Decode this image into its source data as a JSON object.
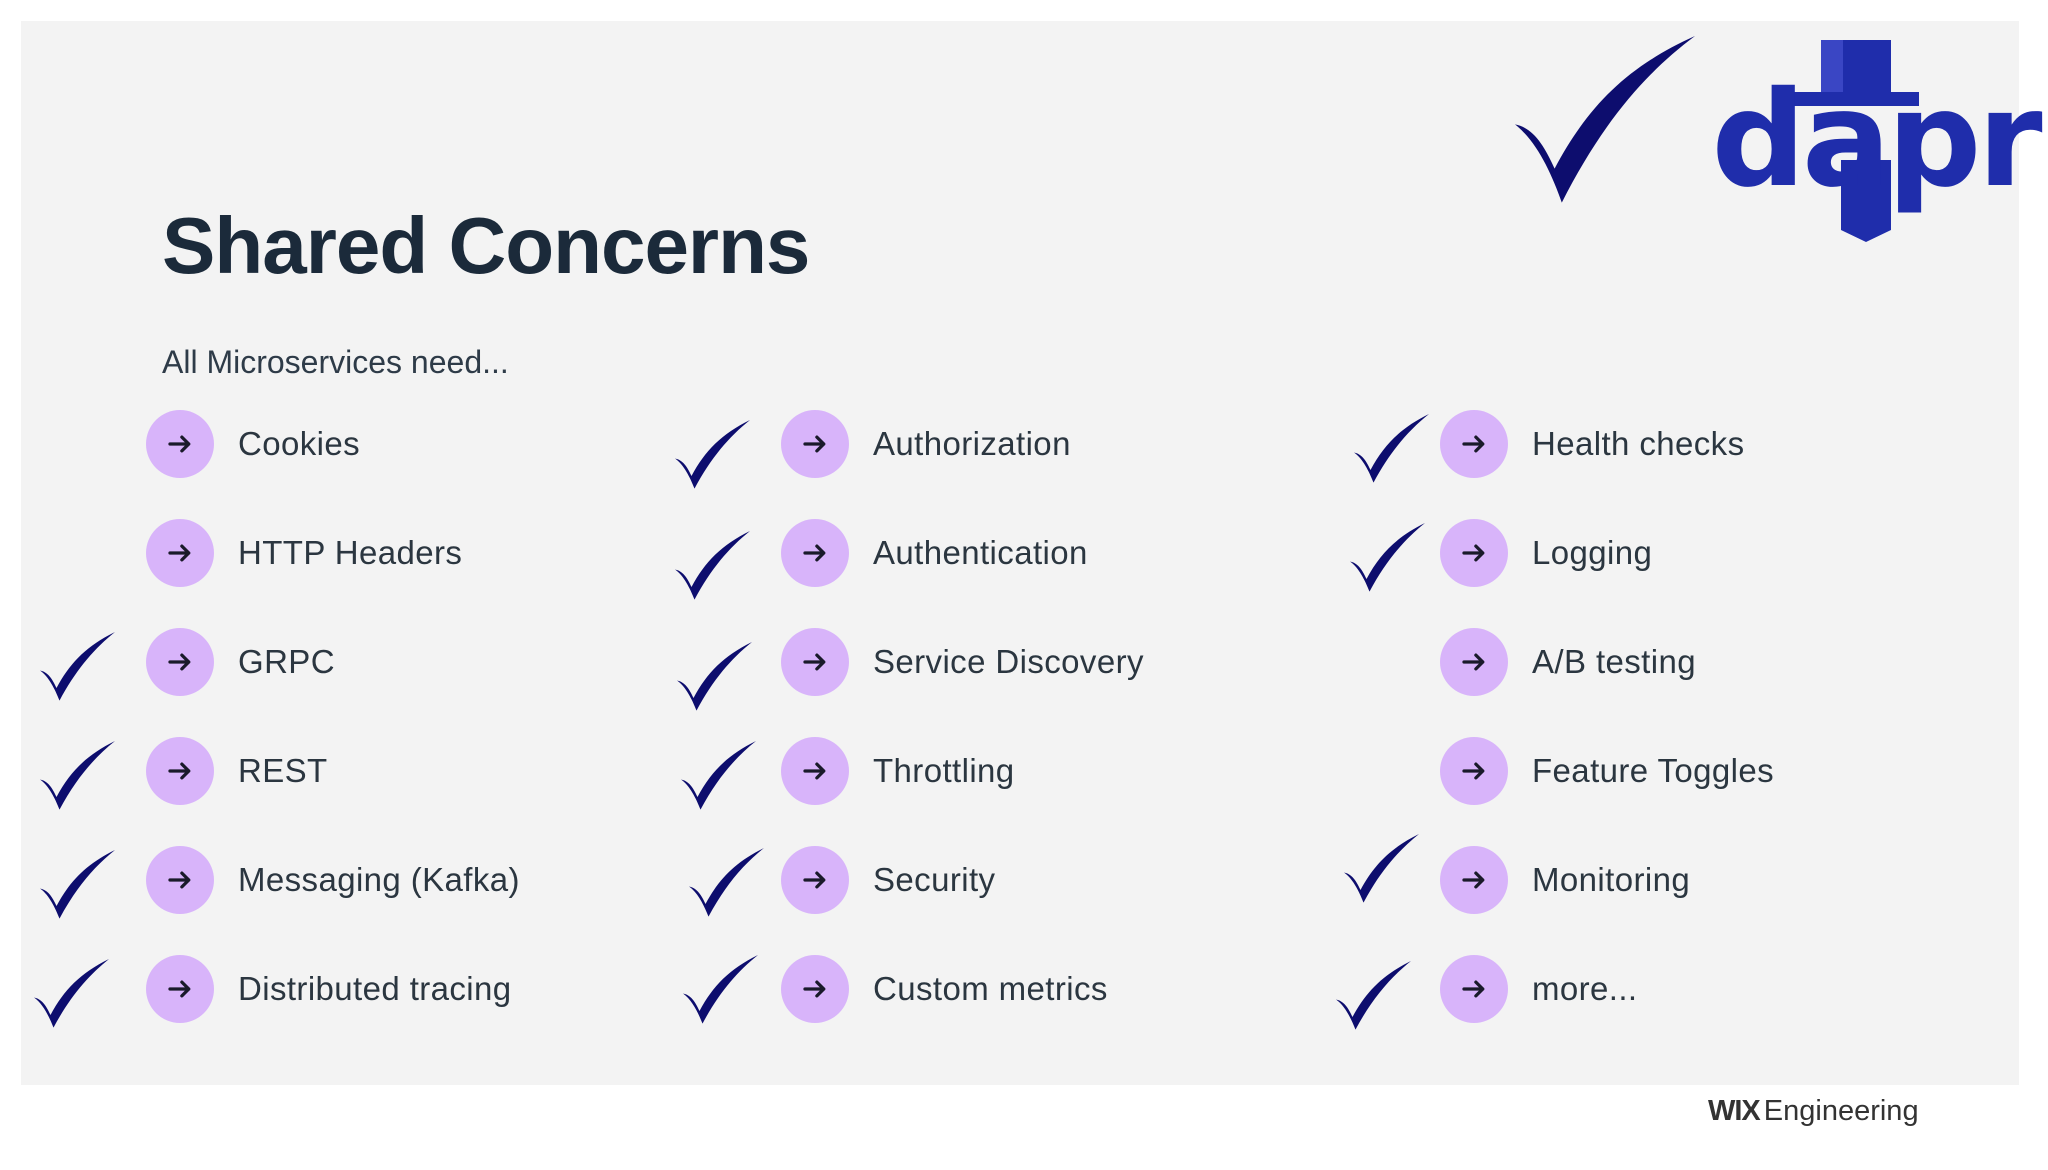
{
  "slide": {
    "title": "Shared Concerns",
    "subtitle": "All Microservices need...",
    "logo_text": "dapr",
    "footer": {
      "brand": "WIX",
      "suffix": "Engineering"
    }
  },
  "colors": {
    "background": "#f3f3f3",
    "bullet": "#d8b4fa",
    "check": "#0d0d6e",
    "logo": "#1f2dab",
    "title": "#1b2a3a"
  },
  "columns": [
    {
      "items": [
        {
          "label": "Cookies",
          "checked": false
        },
        {
          "label": "HTTP Headers",
          "checked": false
        },
        {
          "label": "GRPC",
          "checked": true
        },
        {
          "label": "REST",
          "checked": true
        },
        {
          "label": "Messaging (Kafka)",
          "checked": true
        },
        {
          "label": "Distributed tracing",
          "checked": true
        }
      ]
    },
    {
      "items": [
        {
          "label": "Authorization",
          "checked": true
        },
        {
          "label": "Authentication",
          "checked": true
        },
        {
          "label": "Service Discovery",
          "checked": true
        },
        {
          "label": "Throttling",
          "checked": true
        },
        {
          "label": "Security",
          "checked": true
        },
        {
          "label": "Custom metrics",
          "checked": true
        }
      ]
    },
    {
      "items": [
        {
          "label": "Health checks",
          "checked": true
        },
        {
          "label": "Logging",
          "checked": true
        },
        {
          "label": "A/B testing",
          "checked": false
        },
        {
          "label": "Feature Toggles",
          "checked": false
        },
        {
          "label": "Monitoring",
          "checked": true
        },
        {
          "label": "more...",
          "checked": true
        }
      ]
    }
  ],
  "icons": {
    "bullet": "arrow-right-icon",
    "check": "checkmark-icon",
    "logo": "dapr-logo"
  }
}
